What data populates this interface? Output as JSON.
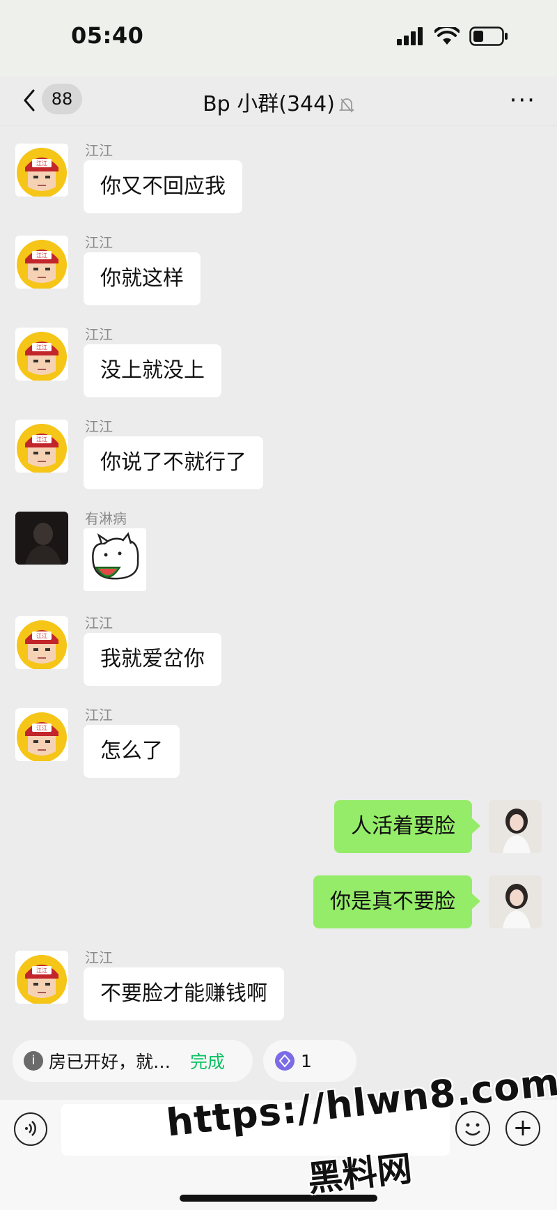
{
  "status_bar": {
    "time": "05:40"
  },
  "header": {
    "back_badge": "88",
    "title": "Bp 小群(344)",
    "more": "···"
  },
  "messages": [
    {
      "sender": "江江",
      "text": "你又不回应我"
    },
    {
      "sender": "江江",
      "text": "你就这样"
    },
    {
      "sender": "江江",
      "text": "没上就没上"
    },
    {
      "sender": "江江",
      "text": "你说了不就行了"
    },
    {
      "sender": "有淋病"
    },
    {
      "sender": "江江",
      "text": "我就爱岔你"
    },
    {
      "sender": "江江",
      "text": "怎么了"
    },
    {
      "text": "人活着要脸"
    },
    {
      "text": "你是真不要脸"
    },
    {
      "sender": "江江",
      "text": "不要脸才能赚钱啊"
    }
  ],
  "pins": {
    "notice_text": "房已开好，就…",
    "notice_action": "完成",
    "count": "1"
  },
  "avatar_badge_text": "江江",
  "watermark": {
    "line1": "https://hlwn8.com",
    "line2": "黑料网"
  },
  "colors": {
    "outgoing_bubble": "#95ec69",
    "accent_green": "#07c160"
  }
}
